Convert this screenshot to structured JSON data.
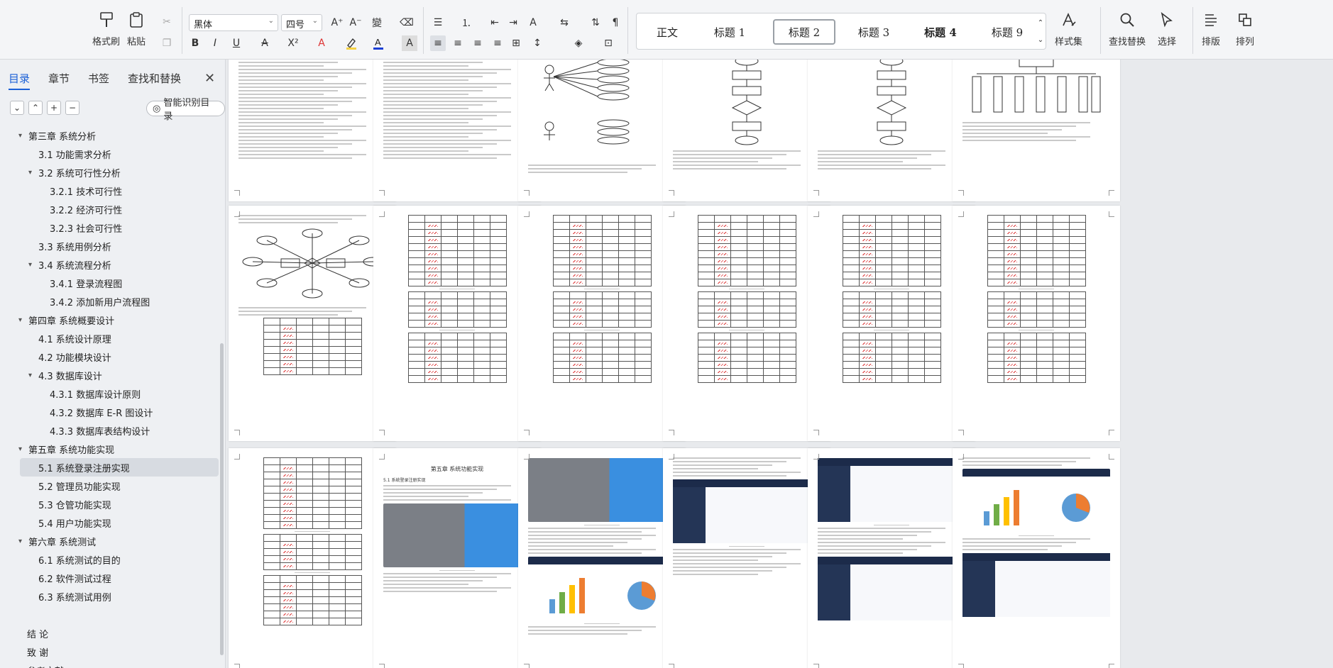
{
  "ribbon": {
    "format_painter": "格式刷",
    "paste": "粘贴",
    "font_name": "黑体",
    "font_size": "四号",
    "style_gallery": [
      "正文",
      "标题 1",
      "标题 2",
      "标题 3",
      "标题 4",
      "标题 9"
    ],
    "active_style": "标题 2",
    "style_set": "样式集",
    "find_replace": "查找替换",
    "select": "选择",
    "typesetting": "排版",
    "arrange": "排列",
    "font_color": "#1a3fd6",
    "highlight_color": "#f5d142"
  },
  "nav": {
    "tabs": [
      "目录",
      "章节",
      "书签",
      "查找和替换"
    ],
    "active_tab": "目录",
    "smart_toc": "智能识别目录",
    "toc": [
      {
        "text": "第三章  系统分析",
        "level": 1,
        "caret": "▾"
      },
      {
        "text": "3.1 功能需求分析",
        "level": 2
      },
      {
        "text": "3.2 系统可行性分析",
        "level": 2,
        "caret": "▾"
      },
      {
        "text": "3.2.1 技术可行性",
        "level": 3
      },
      {
        "text": "3.2.2  经济可行性",
        "level": 3
      },
      {
        "text": "3.2.3 社会可行性",
        "level": 3
      },
      {
        "text": "3.3  系统用例分析",
        "level": 2
      },
      {
        "text": "3.4 系统流程分析",
        "level": 2,
        "caret": "▾"
      },
      {
        "text": "3.4.1  登录流程图",
        "level": 3
      },
      {
        "text": "3.4.2  添加新用户流程图",
        "level": 3
      },
      {
        "text": "第四章  系统概要设计",
        "level": 1,
        "caret": "▾"
      },
      {
        "text": "4.1 系统设计原理",
        "level": 2
      },
      {
        "text": "4.2 功能模块设计",
        "level": 2
      },
      {
        "text": "4.3  数据库设计",
        "level": 2,
        "caret": "▾"
      },
      {
        "text": "4.3.1 数据库设计原则",
        "level": 3
      },
      {
        "text": "4.3.2 数据库 E-R 图设计",
        "level": 3
      },
      {
        "text": "4.3.3 数据库表结构设计",
        "level": 3
      },
      {
        "text": "第五章  系统功能实现",
        "level": 1,
        "caret": "▾"
      },
      {
        "text": "5.1 系统登录注册实现",
        "level": 2,
        "selected": true
      },
      {
        "text": "5.2 管理员功能实现",
        "level": 2
      },
      {
        "text": "5.3 仓管功能实现",
        "level": 2
      },
      {
        "text": "5.4 用户功能实现",
        "level": 2
      },
      {
        "text": "第六章  系统测试",
        "level": 1,
        "caret": "▾"
      },
      {
        "text": "6.1 系统测试的目的",
        "level": 2
      },
      {
        "text": "6.2 软件测试过程",
        "level": 2
      },
      {
        "text": "6.3 系统测试用例",
        "level": 2
      },
      {
        "text": "",
        "level": 0
      },
      {
        "text": "结    论",
        "level": 1
      },
      {
        "text": "致    谢",
        "level": 1
      },
      {
        "text": "参考文献",
        "level": 1
      }
    ]
  },
  "pages": {
    "row3_page2_heading": "第五章  系统功能实现",
    "row3_page2_section": "5.1 系统登录注册实现"
  }
}
